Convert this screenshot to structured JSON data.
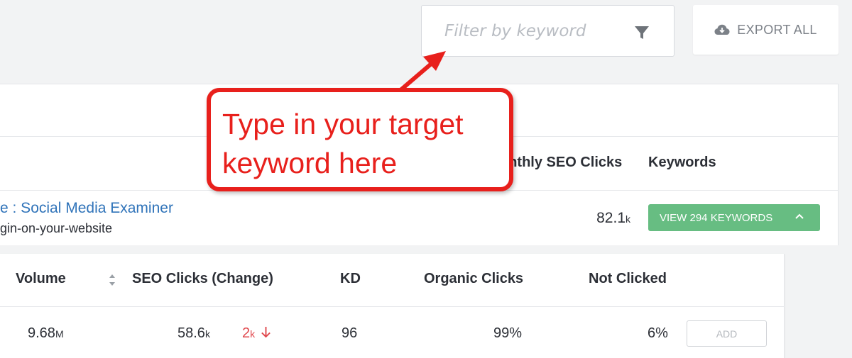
{
  "filter": {
    "placeholder": "Filter by keyword",
    "icon": "funnel-icon"
  },
  "export": {
    "label": "EXPORT ALL",
    "icon": "cloud-download-icon"
  },
  "top_table": {
    "headers": {
      "monthly_seo_clicks": "onthly SEO Clicks",
      "keywords": "Keywords"
    },
    "row": {
      "title": "e : Social Media Examiner",
      "url": "gin-on-your-website",
      "clicks_value": "82.1",
      "clicks_unit": "k",
      "view_button": "VIEW 294 KEYWORDS"
    }
  },
  "keyword_table": {
    "headers": {
      "volume": "Volume",
      "seo_clicks_change": "SEO Clicks (Change)",
      "kd": "KD",
      "organic_clicks": "Organic Clicks",
      "not_clicked": "Not Clicked"
    },
    "row": {
      "volume_value": "9.68",
      "volume_unit": "M",
      "seo_clicks_value": "58.6",
      "seo_clicks_unit": "k",
      "change_value": "2",
      "change_unit": "k",
      "kd": "96",
      "organic_clicks": "99%",
      "not_clicked": "6%",
      "add_label": "ADD"
    }
  },
  "annotation": {
    "line1": "Type in your target",
    "line2": "keyword here"
  },
  "colors": {
    "accent_red": "#e8201c",
    "link_blue": "#2f73b9",
    "button_green": "#67bd82",
    "decrease_red": "#e0474c"
  }
}
